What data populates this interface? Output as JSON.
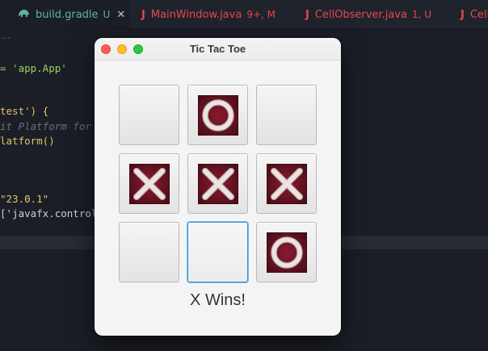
{
  "editor": {
    "tabs": [
      {
        "name": "build.gradle",
        "status": "U",
        "icon": "gradle-elephant-icon",
        "active": true,
        "color": "#5fb3a6"
      },
      {
        "name": "MainWindow.java",
        "status": "9+, M",
        "icon": "java-icon",
        "active": false,
        "color": "#e5484d"
      },
      {
        "name": "CellObserver.java",
        "status": "1, U",
        "icon": "java-icon",
        "active": false,
        "color": "#e5484d"
      },
      {
        "name": "Cell",
        "status": "",
        "icon": "java-icon",
        "active": false,
        "color": "#e5484d"
      }
    ],
    "close_glyph": "✕",
    "java_glyph": "J",
    "breadcrumb": "…",
    "code_lines": [
      {
        "text": "= 'app.App'",
        "color": "#9ece6a"
      },
      {
        "text": "test') {",
        "color": "#e0c36b"
      },
      {
        "text": "it Platform for",
        "color": "#6a6f7a"
      },
      {
        "text": "latform()",
        "color": "#e0c36b"
      },
      {
        "text": "\"23.0.1\"",
        "color": "#e0c36b"
      },
      {
        "text": "['javafx.control",
        "color": "#c9d1d9"
      }
    ]
  },
  "window": {
    "title": "Tic Tac Toe",
    "buttons": [
      "close",
      "minimize",
      "zoom"
    ],
    "board": [
      [
        "",
        "O",
        ""
      ],
      [
        "X",
        "X",
        "X"
      ],
      [
        "",
        "",
        "O"
      ]
    ],
    "focused_cell": [
      2,
      1
    ],
    "status": "X Wins!"
  },
  "colors": {
    "tile_dark": "#4a0d18",
    "tile_mid": "#8b1a2e",
    "mark_light": "#ece4e2",
    "focus_ring": "#2f8fd8"
  }
}
